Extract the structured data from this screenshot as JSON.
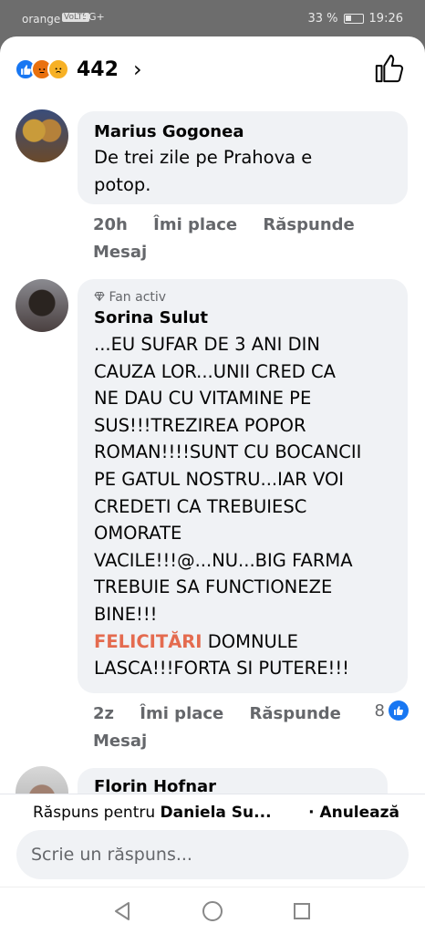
{
  "status_bar": {
    "carrier": "orange",
    "network": "VoLTE",
    "signal": "4G+",
    "battery": "33 %",
    "time": "19:26"
  },
  "reactions": {
    "count": "442",
    "chevron": "›",
    "icons": [
      "like-icon",
      "angry-icon",
      "sad-icon"
    ]
  },
  "comments": [
    {
      "author": "Marius Gogonea",
      "text_lines": [
        "De trei zile pe Prahova e",
        "potop."
      ],
      "time": "20h",
      "like_label": "Îmi place",
      "reply_label": "Răspunde",
      "message_label": "Mesaj"
    },
    {
      "badge": "Fan activ",
      "author": "Sorina Sulut",
      "text_lines": [
        "...EU SUFAR DE 3 ANI DIN",
        "CAUZA LOR...UNII CRED CA",
        "NE DAU CU VITAMINE  PE",
        "SUS!!!TREZIREA POPOR",
        "ROMAN!!!!SUNT CU BOCANCII",
        "PE GATUL NOSTRU...IAR VOI",
        "CREDETI CA TREBUIESC",
        "OMORATE",
        "VACILE!!!@...NU...BIG FARMA",
        "TREBUIE SA FUNCTIONEZE",
        "BINE!!!"
      ],
      "highlight_tag": "FELICITĂRI",
      "text_after_tag": " DOMNULE",
      "last_line": "LASCA!!!FORTA SI PUTERE!!!",
      "time": "2z",
      "like_label": "Îmi place",
      "reply_label": "Răspunde",
      "message_label": "Mesaj",
      "reaction_count": "8"
    },
    {
      "author": "Florin Hofnar"
    }
  ],
  "reply_bar": {
    "prefix": "Răspuns pentru ",
    "target": "Daniela Su...",
    "cancel": "· Anulează",
    "placeholder": "Scrie un răspuns..."
  },
  "colors": {
    "like_blue": "#1877f2",
    "tag_orange": "#e46b4f",
    "bubble_bg": "#f0f2f5",
    "secondary_text": "#65676b"
  }
}
